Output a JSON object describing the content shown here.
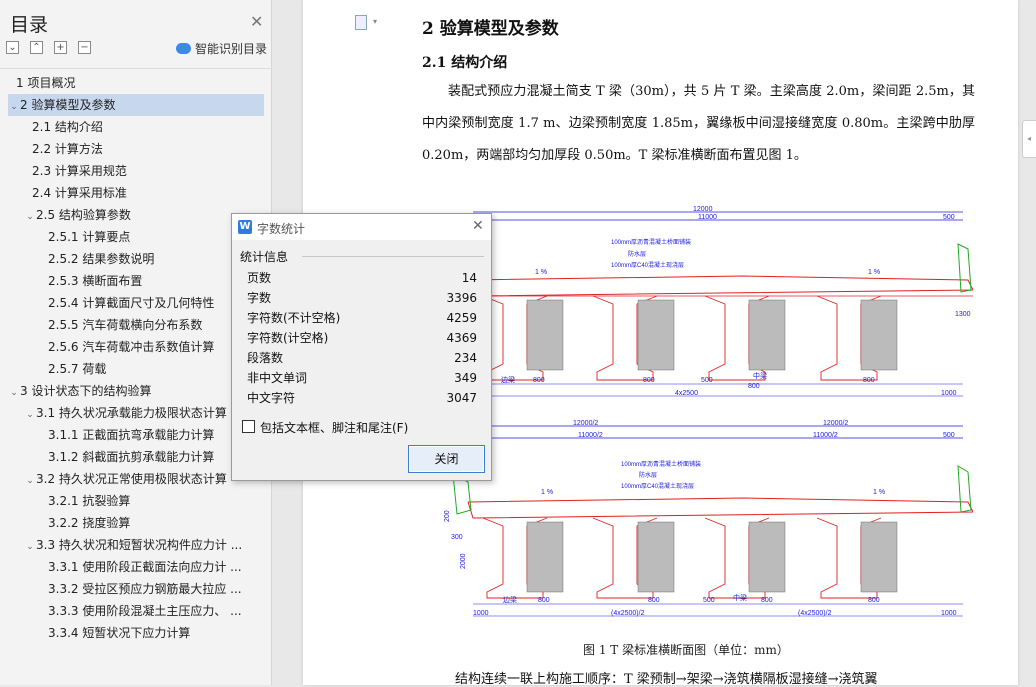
{
  "sidebar": {
    "title": "目录",
    "smart_toc_label": "智能识别目录",
    "toolbar": [
      "⌄",
      "⌃",
      "+",
      "−"
    ],
    "items": [
      {
        "label": "1 项目概况",
        "level": 0,
        "arrow": ""
      },
      {
        "label": "2 验算模型及参数",
        "level": 0,
        "arrow": "v",
        "active": true
      },
      {
        "label": "2.1 结构介绍",
        "level": 1,
        "arrow": ""
      },
      {
        "label": "2.2  计算方法",
        "level": 1,
        "arrow": ""
      },
      {
        "label": "2.3  计算采用规范",
        "level": 1,
        "arrow": ""
      },
      {
        "label": "2.4  计算采用标准",
        "level": 1,
        "arrow": ""
      },
      {
        "label": "2.5 结构验算参数",
        "level": 1,
        "arrow": "v"
      },
      {
        "label": "2.5.1  计算要点",
        "level": 2,
        "arrow": ""
      },
      {
        "label": "2.5.2  结果参数说明",
        "level": 2,
        "arrow": ""
      },
      {
        "label": "2.5.3  横断面布置",
        "level": 2,
        "arrow": ""
      },
      {
        "label": "2.5.4 计算截面尺寸及几何特性",
        "level": 2,
        "arrow": ""
      },
      {
        "label": "2.5.5 汽车荷载横向分布系数",
        "level": 2,
        "arrow": ""
      },
      {
        "label": "2.5.6 汽车荷载冲击系数值计算",
        "level": 2,
        "arrow": ""
      },
      {
        "label": "2.5.7  荷载",
        "level": 2,
        "arrow": ""
      },
      {
        "label": "3 设计状态下的结构验算",
        "level": 0,
        "arrow": "v"
      },
      {
        "label": "3.1  持久状况承载能力极限状态计算",
        "level": 1,
        "arrow": "v"
      },
      {
        "label": "3.1.1 正截面抗弯承载能力计算",
        "level": 2,
        "arrow": ""
      },
      {
        "label": "3.1.2  斜截面抗剪承载能力计算",
        "level": 2,
        "arrow": ""
      },
      {
        "label": "3.2 持久状况正常使用极限状态计算",
        "level": 1,
        "arrow": "v"
      },
      {
        "label": "3.2.1  抗裂验算",
        "level": 2,
        "arrow": ""
      },
      {
        "label": "3.2.2  挠度验算",
        "level": 2,
        "arrow": ""
      },
      {
        "label": "3.3  持久状况和短暂状况构件应力计 ...",
        "level": 1,
        "arrow": "v"
      },
      {
        "label": "3.3.1  使用阶段正截面法向应力计 ...",
        "level": 2,
        "arrow": ""
      },
      {
        "label": "3.3.2 受拉区预应力钢筋最大拉应 ...",
        "level": 2,
        "arrow": ""
      },
      {
        "label": "3.3.3 使用阶段混凝土主压应力、 ...",
        "level": 2,
        "arrow": ""
      },
      {
        "label": "3.3.4  短暂状况下应力计算",
        "level": 2,
        "arrow": ""
      }
    ]
  },
  "document": {
    "heading2": "2 验算模型及参数",
    "heading3": "2.1 结构介绍",
    "paragraph": "装配式预应力混凝土简支 T 梁（30m），共 5 片 T 梁。主梁高度 2.0m，梁间距 2.5m，其中内梁预制宽度 1.7 m、边梁预制宽度 1.85m，翼缘板中间湿接缝宽度 0.80m。主梁跨中肋厚 0.20m，两端部均匀加厚段 0.50m。T 梁标准横断面布置见图 1。",
    "figure_caption": "图 1 T 梁标准横断面图（单位：mm）",
    "next_line": "结构连续一联上构施工顺序：T 梁预制→架梁→浇筑横隔板湿接缝→浇筑翼",
    "figure_texts": {
      "top_dim1": "12000",
      "top_dim2": "11000",
      "top_dim3": "500",
      "layer1": "100mm厚沥青混凝土桥面铺装",
      "layer2": "防水层",
      "layer3": "100mm厚C40混凝土现浇层",
      "slope": "1 %",
      "dim_800": "800",
      "dim_500": "500",
      "side_beam": "边梁",
      "mid_beam": "中梁",
      "span": "4x2500",
      "dim_1000": "1000",
      "dim_1300": "1300",
      "half_12000": "12000/2",
      "half_11000": "11000/2",
      "half_span": "(4x2500)/2",
      "dim_2000": "2000",
      "dim_200": "200",
      "dim_300": "300"
    }
  },
  "dialog": {
    "title": "字数统计",
    "section": "统计信息",
    "stats": [
      {
        "label": "页数",
        "value": "14"
      },
      {
        "label": "字数",
        "value": "3396"
      },
      {
        "label": "字符数(不计空格)",
        "value": "4259"
      },
      {
        "label": "字符数(计空格)",
        "value": "4369"
      },
      {
        "label": "段落数",
        "value": "234"
      },
      {
        "label": "非中文单词",
        "value": "349"
      },
      {
        "label": "中文字符",
        "value": "3047"
      }
    ],
    "checkbox_label": "包括文本框、脚注和尾注(F)",
    "close_button": "关闭"
  },
  "colors": {
    "accent": "#2f7be0",
    "toc_active": "#c7d8ee",
    "drawing_red": "#e02020",
    "drawing_blue": "#1a1adf",
    "drawing_green": "#22aa22"
  }
}
